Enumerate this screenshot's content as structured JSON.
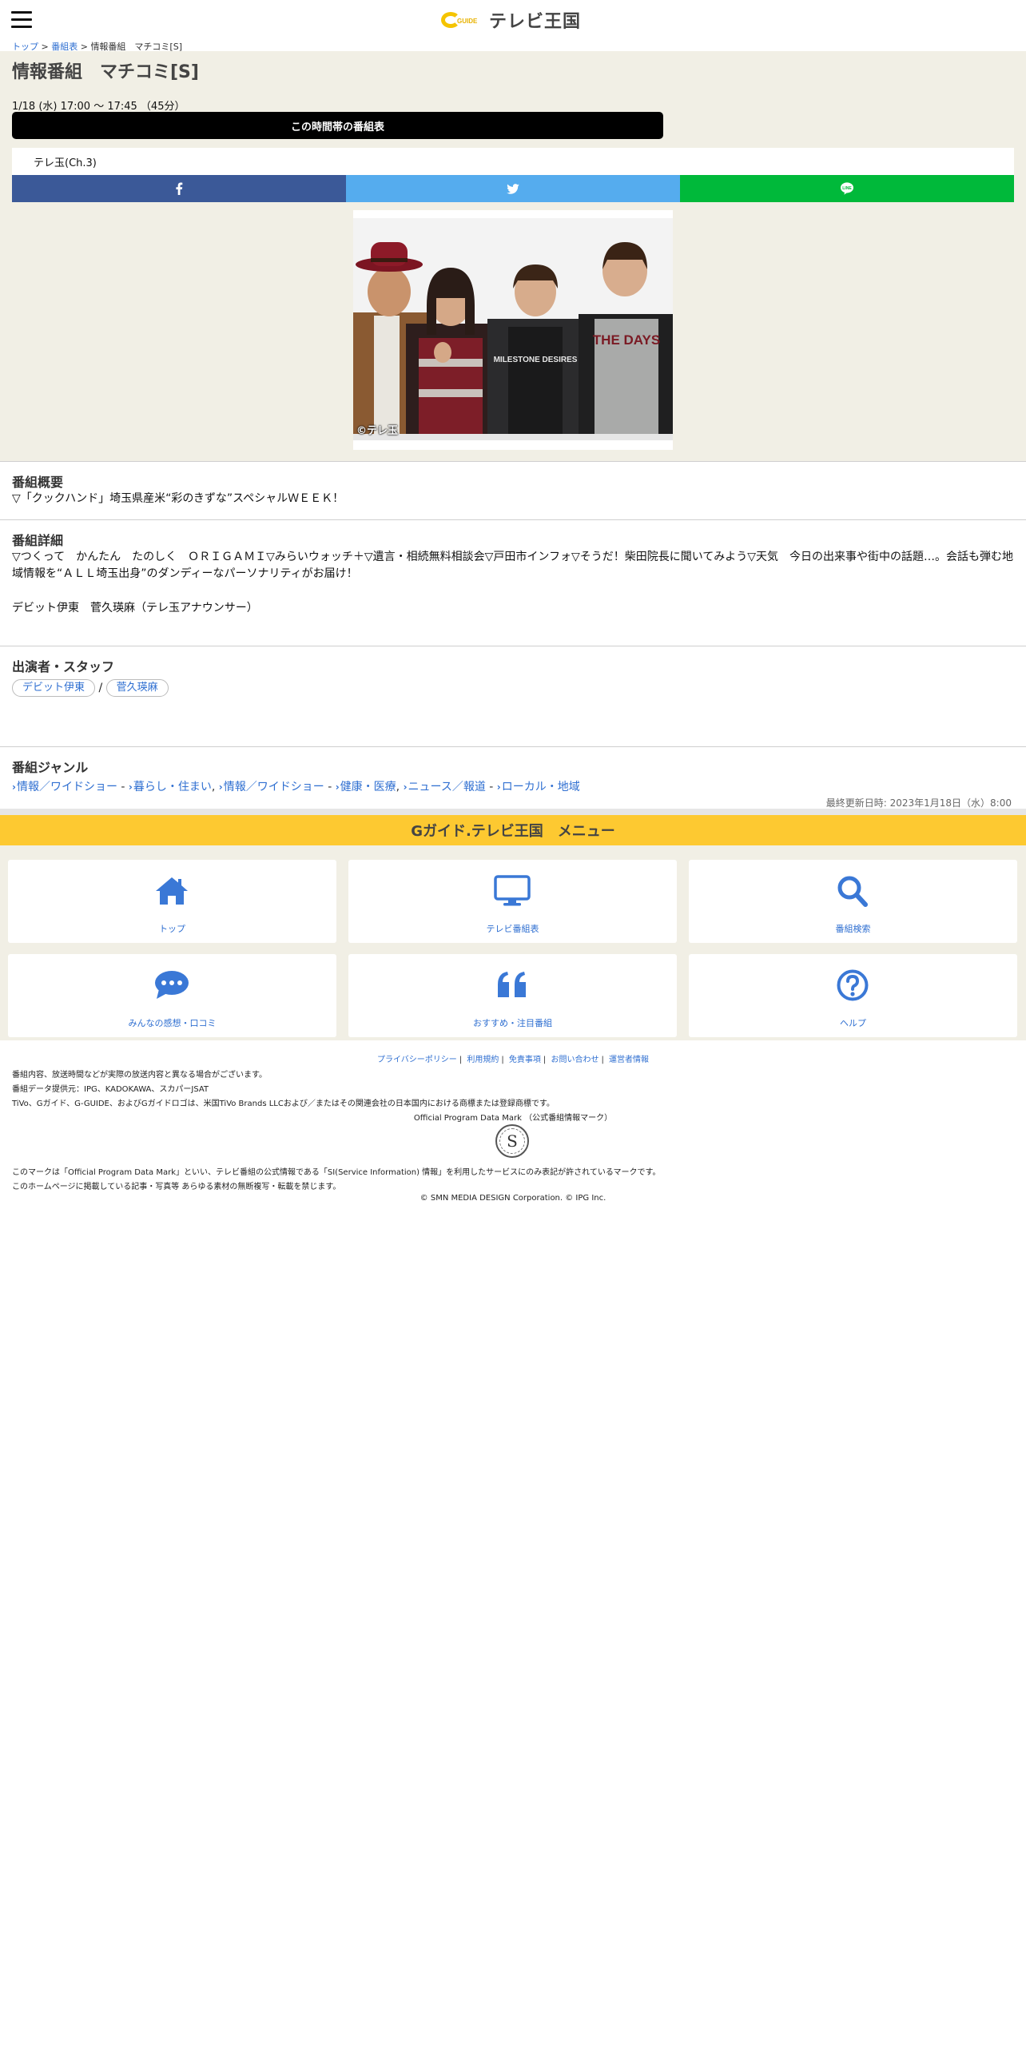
{
  "header": {
    "logo_sub": "GUIDE",
    "logo_text": "テレビ王国"
  },
  "breadcrumb": {
    "items": [
      "トップ",
      "番組表",
      "情報番組　マチコミ[S]"
    ],
    "separator": ">"
  },
  "program": {
    "title": "情報番組　マチコミ[S]",
    "airtime": "1/18 (水) 17:00 ～ 17:45 （45分）",
    "schedule_button": "この時間帯の番組表",
    "channel": "テレ玉(Ch.3)",
    "photo_credit": "©テレ玉",
    "shirt_text_left": "MILESTONE DESIRES",
    "shirt_text_right": "THE DAYS"
  },
  "share": {
    "facebook_icon": "facebook-icon",
    "twitter_icon": "twitter-icon",
    "line_icon": "line-icon"
  },
  "overview": {
    "title": "番組概要",
    "text": "▽「クックハンド」埼玉県産米“彩のきずな”スペシャルＷＥＥＫ！"
  },
  "detail": {
    "title": "番組詳細",
    "text1": "▽つくって　かんたん　たのしく　ＯＲＩＧＡＭＩ▽みらいウォッチ＋▽遺言・相続無料相談会▽戸田市インフォ▽そうだ！柴田院長に聞いてみよう▽天気　今日の出来事や街中の話題…。会話も弾む地域情報を“ＡＬＬ埼玉出身”のダンディーなパーソナリティがお届け！",
    "text2": "デビット伊東　菅久瑛麻（テレ玉アナウンサー）"
  },
  "cast": {
    "title": "出演者・スタッフ",
    "members": [
      "デビット伊東",
      "菅久瑛麻"
    ],
    "separator": "/"
  },
  "genre": {
    "title": "番組ジャンル",
    "groups": [
      {
        "main": "情報／ワイドショー",
        "sub": "暮らし・住まい"
      },
      {
        "main": "情報／ワイドショー",
        "sub": "健康・医療"
      },
      {
        "main": "ニュース／報道",
        "sub": "ローカル・地域"
      }
    ],
    "dash": "-",
    "comma": ","
  },
  "updated": "最終更新日時: 2023年1月18日（水）8:00",
  "menu": {
    "title": "Gガイド.テレビ王国　メニュー",
    "tiles": [
      {
        "label": "トップ",
        "icon": "home-icon"
      },
      {
        "label": "テレビ番組表",
        "icon": "tv-icon"
      },
      {
        "label": "番組検索",
        "icon": "search-icon"
      },
      {
        "label": "みんなの感想・口コミ",
        "icon": "comment-icon"
      },
      {
        "label": "おすすめ・注目番組",
        "icon": "quote-icon"
      },
      {
        "label": "ヘルプ",
        "icon": "help-icon"
      }
    ],
    "accent_color": "#3a78d6",
    "bar_color": "#fdc931"
  },
  "footer": {
    "links": [
      "プライバシーポリシー",
      "利用規約",
      "免責事項",
      "お問い合わせ",
      "運営者情報"
    ],
    "link_separator": "|",
    "line1": "番組内容、放送時間などが実際の放送内容と異なる場合がございます。",
    "line2": "番組データ提供元：IPG、KADOKAWA、スカパーJSAT",
    "line3": "TiVo、Gガイド、G-GUIDE、およびGガイドロゴは、米国TiVo Brands LLCおよび／またはその関連会社の日本国内における商標または登録商標です。",
    "mark_caption": "Official Program Data Mark （公式番組情報マーク）",
    "mark_letter": "S",
    "line4": "このマークは「Official Program Data Mark」といい、テレビ番組の公式情報である「SI(Service Information) 情報」を利用したサービスにのみ表記が許されているマークです。",
    "line5": "このホームページに掲載している記事・写真等 あらゆる素材の無断複写・転載を禁じます。",
    "copyright": "© SMN MEDIA DESIGN Corporation. © IPG Inc."
  }
}
